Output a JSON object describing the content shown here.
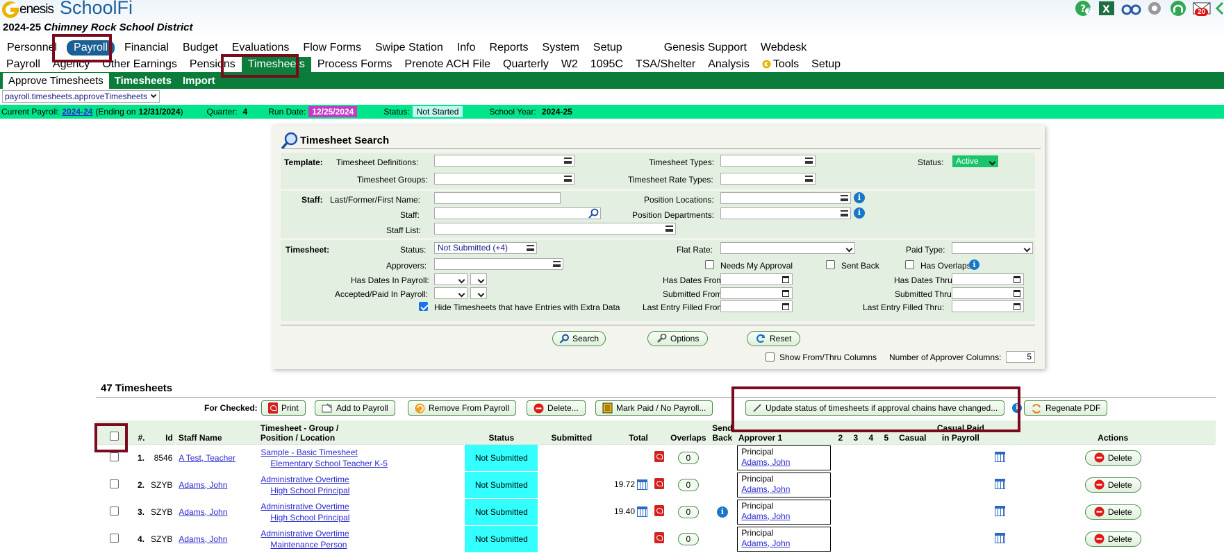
{
  "header": {
    "logo_genesis": "enesis",
    "logo_app": "SchoolFi",
    "school_year": "2024-25",
    "district": "Chimney Rock School District",
    "help_badge": "7",
    "mail_badge": "20"
  },
  "main_nav": [
    "Personnel",
    "Payroll",
    "Financial",
    "Budget",
    "Evaluations",
    "Flow Forms",
    "Swipe Station",
    "Info",
    "Reports",
    "System",
    "Setup",
    "Genesis Support",
    "Webdesk"
  ],
  "main_nav_active": "Payroll",
  "sub_nav": [
    "Payroll",
    "Agency",
    "Other Earnings",
    "Pensions",
    "Timesheets",
    "Process Forms",
    "Prenote ACH File",
    "Quarterly",
    "W2",
    "1095C",
    "TSA/Shelter",
    "Analysis",
    "Tools",
    "Setup"
  ],
  "sub_nav_active": "Timesheets",
  "tabs": [
    "Approve Timesheets",
    "Timesheets",
    "Import"
  ],
  "page_select": "payroll.timesheets.approveTimesheets",
  "payroll_bar": {
    "current_payroll_label": "Current Payroll:",
    "current_payroll": "2024-24",
    "ending_prefix": "(Ending on",
    "ending_date": "12/31/2024",
    "ending_suffix": ")",
    "quarter_label": "Quarter:",
    "quarter": "4",
    "run_date_label": "Run Date:",
    "run_date": "12/25/2024",
    "status_label": "Status:",
    "status": "Not Started",
    "school_year_label": "School Year:",
    "school_year": "2024-25"
  },
  "search": {
    "title": "Timesheet Search",
    "template_label": "Template:",
    "timesheet_definitions": "Timesheet Definitions:",
    "timesheet_types": "Timesheet Types:",
    "status_label": "Status:",
    "status_value": "Active",
    "timesheet_groups": "Timesheet Groups:",
    "timesheet_rate_types": "Timesheet Rate Types:",
    "staff_label": "Staff:",
    "last_first_name": "Last/Former/First Name:",
    "position_locations": "Position Locations:",
    "staff": "Staff:",
    "position_departments": "Position Departments:",
    "staff_list": "Staff List:",
    "timesheet_label": "Timesheet:",
    "ts_status": "Status:",
    "ts_status_value": "Not Submitted (+4)",
    "flat_rate": "Flat Rate:",
    "paid_type": "Paid Type:",
    "approvers": "Approvers:",
    "needs_my_approval": "Needs My Approval",
    "sent_back": "Sent Back",
    "has_overlaps": "Has Overlaps",
    "has_dates_in_payroll": "Has Dates In Payroll:",
    "has_dates_from": "Has Dates From:",
    "has_dates_thru": "Has Dates Thru:",
    "accepted_paid_in_payroll": "Accepted/Paid In Payroll:",
    "submitted_from": "Submitted From:",
    "submitted_thru": "Submitted Thru:",
    "hide_extra_data": "Hide Timesheets that have Entries with Extra Data",
    "last_entry_filled_from": "Last Entry Filled From:",
    "last_entry_filled_thru": "Last Entry Filled Thru:",
    "search_btn": "Search",
    "options_btn": "Options",
    "reset_btn": "Reset",
    "show_from_thru": "Show From/Thru Columns",
    "num_approver_cols_label": "Number of Approver Columns:",
    "num_approver_cols": "5"
  },
  "results": {
    "count_title": "47 Timesheets",
    "for_checked": "For Checked:",
    "buttons": {
      "print": "Print",
      "add_to_payroll": "Add to Payroll",
      "remove_from_payroll": "Remove From Payroll",
      "delete": "Delete...",
      "mark_paid": "Mark Paid / No Payroll...",
      "update_status": "Update status of timesheets if approval chains have changed...",
      "regenerate_pdf": "Regenate PDF"
    },
    "columns": {
      "num": "#.",
      "id": "Id",
      "staff_name": "Staff Name",
      "group_line1": "Timesheet - Group /",
      "group_line2": "Position / Location",
      "status": "Status",
      "submitted": "Submitted",
      "total": "Total",
      "overlaps": "Overlaps",
      "send_line1": "Send",
      "send_line2": "Back",
      "approver1": "Approver 1",
      "a2": "2",
      "a3": "3",
      "a4": "4",
      "a5": "5",
      "casual": "Casual",
      "casual_paid_line1": "Casual Paid",
      "casual_paid_line2": "in Payroll",
      "actions": "Actions"
    },
    "rows": [
      {
        "num": "1.",
        "id": "8546",
        "staff": "A Test, Teacher",
        "group": "Sample - Basic Timesheet",
        "position": "Elementary School Teacher K-5",
        "status": "Not Submitted",
        "total": "",
        "overlaps": "0",
        "info": false,
        "approver_role": "Principal",
        "approver_name": "Adams, John",
        "delete": "Delete"
      },
      {
        "num": "2.",
        "id": "SZYB",
        "staff": "Adams, John",
        "group": "Administrative Overtime",
        "position": "High School Principal",
        "status": "Not Submitted",
        "total": "19.72",
        "overlaps": "0",
        "info": false,
        "approver_role": "Principal",
        "approver_name": "Adams, John",
        "delete": "Delete"
      },
      {
        "num": "3.",
        "id": "SZYB",
        "staff": "Adams, John",
        "group": "Administrative Overtime",
        "position": "High School Principal",
        "status": "Not Submitted",
        "total": "19.40",
        "overlaps": "0",
        "info": true,
        "approver_role": "Principal",
        "approver_name": "Adams, John",
        "delete": "Delete"
      },
      {
        "num": "4.",
        "id": "SZYB",
        "staff": "Adams, John",
        "group": "Administrative Overtime",
        "position": "Maintenance Person",
        "status": "Not Submitted",
        "total": "",
        "overlaps": "0",
        "info": false,
        "approver_role": "Principal",
        "approver_name": "Adams, John",
        "delete": "Delete"
      }
    ]
  },
  "colors": {
    "brand_blue": "#1b5f95",
    "tab_green": "#0a7d3a",
    "payroll_bar": "#00e58a",
    "run_date": "#c738c7",
    "status_cyan": "#33ffff",
    "highlight": "#7a0a1e"
  }
}
